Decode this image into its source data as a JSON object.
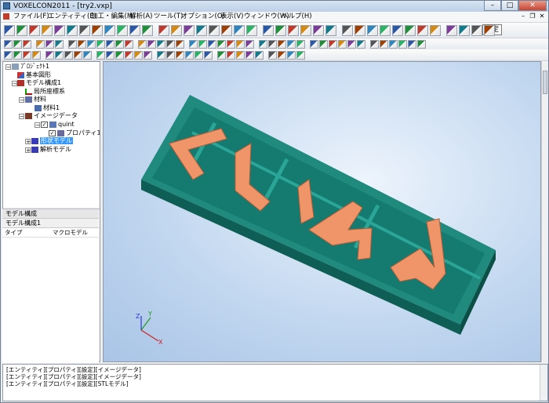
{
  "window": {
    "title": "VOXELCON2011 - [try2.vxp]",
    "buttons": {
      "minimize": "–",
      "maximize": "□",
      "close": "✕"
    }
  },
  "menu": {
    "items": [
      {
        "label": "ファイル(F)"
      },
      {
        "label": "エンティティ(E)"
      },
      {
        "label": "加工・編集(M)"
      },
      {
        "label": "解析(A)"
      },
      {
        "label": "ツール(T)"
      },
      {
        "label": "オプション(O)"
      },
      {
        "label": "表示(V)"
      },
      {
        "label": "ウィンドウ(W)"
      },
      {
        "label": "ヘルプ(H)"
      }
    ],
    "mdi": {
      "minimize": "–",
      "restore": "❐",
      "close": "✕"
    }
  },
  "toolbar": {
    "settings_label": "設定"
  },
  "tree": {
    "items": [
      {
        "label": "ﾌﾟﾛｼﾞｪｸﾄ1",
        "icon": "project-icon"
      },
      {
        "label": "基本図形",
        "icon": "shapes-icon"
      },
      {
        "label": "モデル構成1",
        "icon": "model-config-icon"
      },
      {
        "label": "局所座標系",
        "icon": "axes-icon"
      },
      {
        "label": "材料",
        "icon": "material-folder-icon"
      },
      {
        "label": "材料1",
        "icon": "material-icon"
      },
      {
        "label": "イメージデータ",
        "icon": "image-data-icon"
      },
      {
        "label": "quint",
        "icon": "image-icon"
      },
      {
        "label": "プロパティ1",
        "icon": "property-icon"
      },
      {
        "label": "形状モデル",
        "icon": "shape-model-icon"
      },
      {
        "label": "解析モデル",
        "icon": "analysis-model-icon"
      }
    ]
  },
  "properties": {
    "header": "モデル構成",
    "name": "モデル構成1",
    "rows": [
      {
        "key": "タイプ",
        "value": "マクロモデル"
      }
    ]
  },
  "viewport": {
    "axis_x": "X",
    "axis_y": "Y",
    "axis_z": "Z",
    "colors": {
      "tray": "#157a6f",
      "letters": "#f0956a"
    }
  },
  "console": {
    "lines": [
      "[エンティティ][プロパティ][設定][イメージデータ]",
      "[エンティティ][プロパティ][設定][イメージデータ]",
      "[エンティティ][プロパティ][設定][STLモデル]"
    ]
  }
}
